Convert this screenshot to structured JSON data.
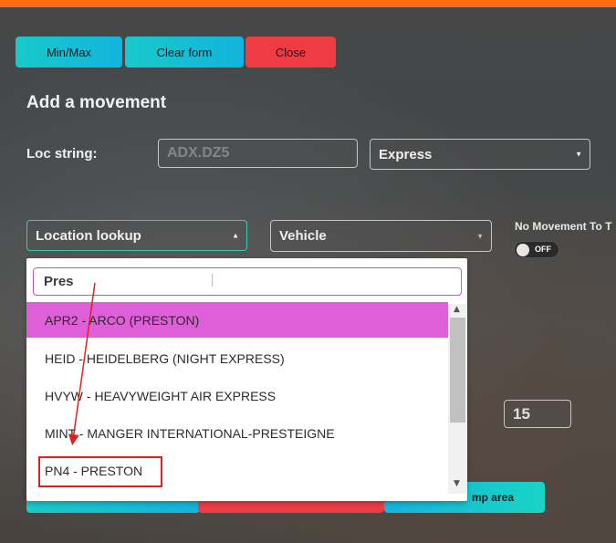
{
  "toolbar": {
    "minmax_label": "Min/Max",
    "clear_label": "Clear form",
    "close_label": "Close"
  },
  "form": {
    "heading": "Add a movement",
    "loc_string_label": "Loc string:",
    "loc_string_placeholder": "ADX.DZ5",
    "service_select": "Express",
    "location_lookup": "Location lookup",
    "vehicle_select": "Vehicle",
    "no_movement_label": "No Movement To T",
    "toggle_state": "OFF",
    "number_value": "15",
    "bottom_button_label": "mp area"
  },
  "dropdown": {
    "search_value": "Pres",
    "options": [
      {
        "label": "APR2 - ARCO (PRESTON)",
        "highlighted": true
      },
      {
        "label": "HEID - HEIDELBERG (NIGHT EXPRESS)",
        "highlighted": false
      },
      {
        "label": "HVYW - HEAVYWEIGHT AIR EXPRESS",
        "highlighted": false
      },
      {
        "label": "MINT - MANGER INTERNATIONAL-PRESTEIGNE",
        "highlighted": false
      },
      {
        "label": "PN4 - PRESTON",
        "highlighted": false
      }
    ]
  },
  "colors": {
    "accent_orange": "#ff6a13",
    "teal": "#18c9c9",
    "red": "#ef3b43",
    "highlight": "#df5fd9",
    "annotation": "#e0201d"
  }
}
